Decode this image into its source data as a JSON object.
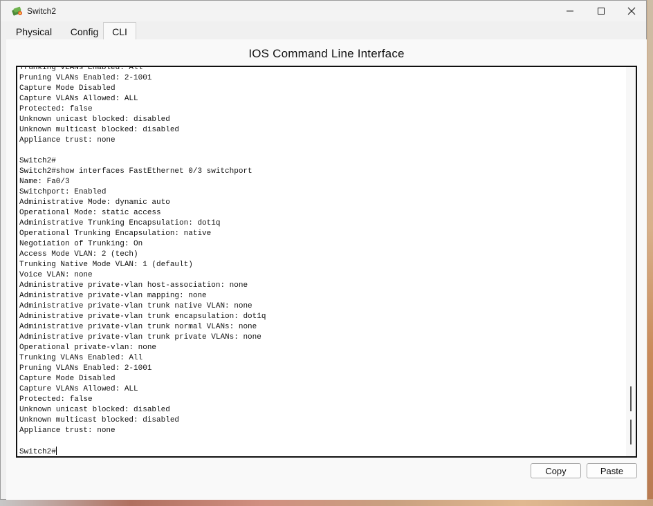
{
  "window": {
    "title": "Switch2",
    "icon": "packet-tracer-switch-icon",
    "controls": {
      "minimize_icon": "minimize-icon",
      "maximize_icon": "maximize-icon",
      "close_icon": "close-icon"
    }
  },
  "tabs": [
    {
      "label": "Physical",
      "active": false
    },
    {
      "label": "Config",
      "active": false
    },
    {
      "label": "CLI",
      "active": true
    }
  ],
  "cli": {
    "header": "IOS Command Line Interface",
    "lines": [
      "Trunking VLANs Enabled: All",
      "Pruning VLANs Enabled: 2-1001",
      "Capture Mode Disabled",
      "Capture VLANs Allowed: ALL",
      "Protected: false",
      "Unknown unicast blocked: disabled",
      "Unknown multicast blocked: disabled",
      "Appliance trust: none",
      "",
      "Switch2#",
      "Switch2#show interfaces FastEthernet 0/3 switchport",
      "Name: Fa0/3",
      "Switchport: Enabled",
      "Administrative Mode: dynamic auto",
      "Operational Mode: static access",
      "Administrative Trunking Encapsulation: dot1q",
      "Operational Trunking Encapsulation: native",
      "Negotiation of Trunking: On",
      "Access Mode VLAN: 2 (tech)",
      "Trunking Native Mode VLAN: 1 (default)",
      "Voice VLAN: none",
      "Administrative private-vlan host-association: none",
      "Administrative private-vlan mapping: none",
      "Administrative private-vlan trunk native VLAN: none",
      "Administrative private-vlan trunk encapsulation: dot1q",
      "Administrative private-vlan trunk normal VLANs: none",
      "Administrative private-vlan trunk private VLANs: none",
      "Operational private-vlan: none",
      "Trunking VLANs Enabled: All",
      "Pruning VLANs Enabled: 2-1001",
      "Capture Mode Disabled",
      "Capture VLANs Allowed: ALL",
      "Protected: false",
      "Unknown unicast blocked: disabled",
      "Unknown multicast blocked: disabled",
      "Appliance trust: none",
      ""
    ],
    "prompt": "Switch2#"
  },
  "buttons": {
    "copy": "Copy",
    "paste": "Paste"
  }
}
